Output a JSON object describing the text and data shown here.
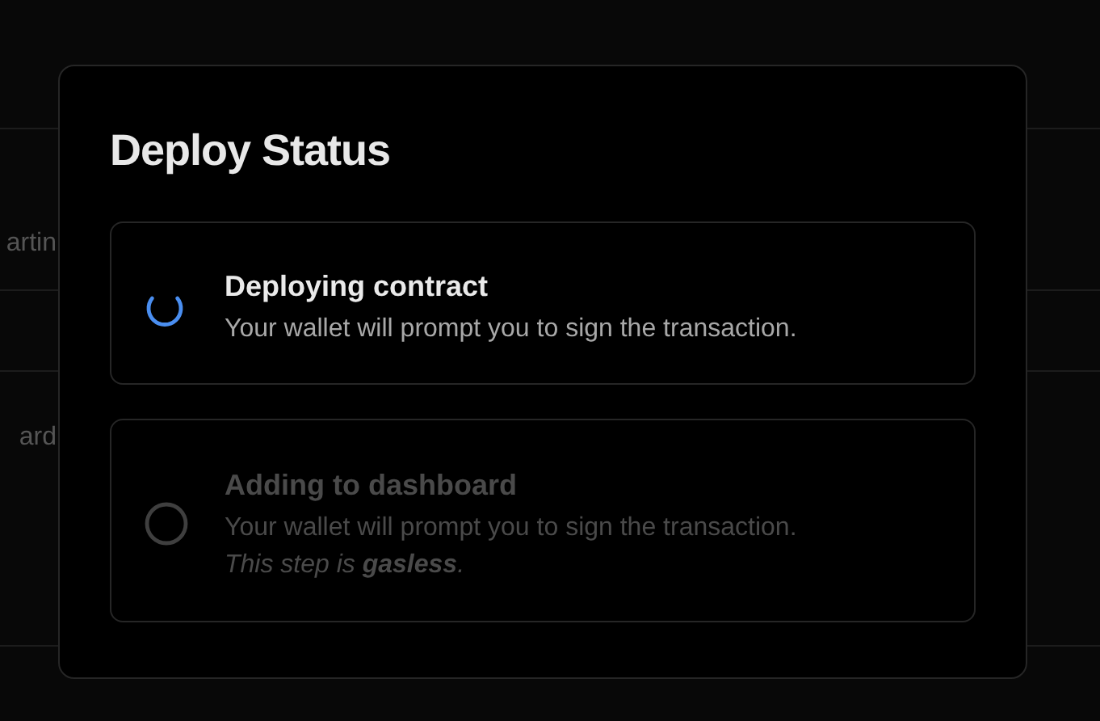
{
  "background_rows": [
    {
      "text": "artin"
    },
    {
      "text": "ard"
    }
  ],
  "dialog": {
    "title": "Deploy Status",
    "steps": [
      {
        "kind": "loading",
        "title": "Deploying contract",
        "description": "Your wallet will prompt you to sign the transaction."
      },
      {
        "kind": "pending",
        "title": "Adding to dashboard",
        "description": "Your wallet will prompt you to sign the transaction.",
        "note": "This step is **gasless**."
      }
    ]
  }
}
